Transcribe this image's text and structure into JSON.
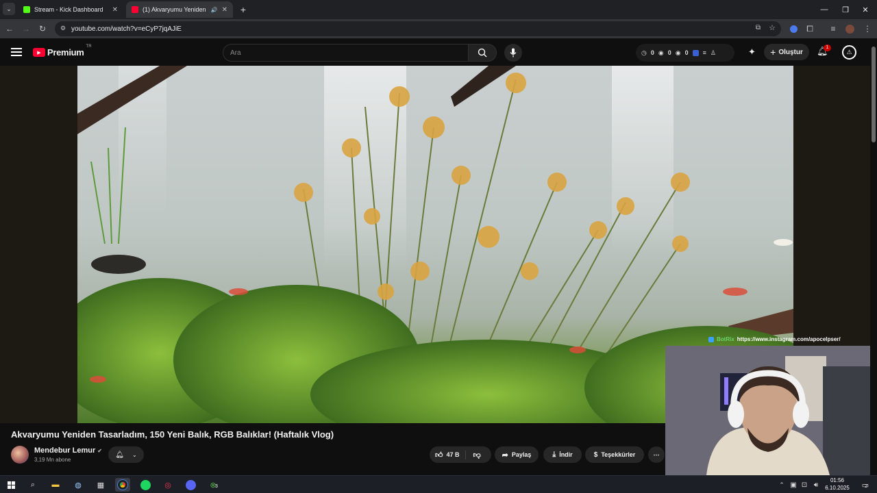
{
  "browser": {
    "tabs": [
      {
        "title": "Stream - Kick Dashboard",
        "favicon_color": "#53fc18"
      },
      {
        "title": "(1) Akvaryumu Yeniden Tasa",
        "favicon_color": "#ff0033"
      }
    ],
    "url": "youtube.com/watch?v=eCyP7jqAJiE"
  },
  "youtube": {
    "logo_text": "Premium",
    "region": "TR",
    "search_placeholder": "Ara",
    "ext_counts": [
      "0",
      "0",
      "0"
    ],
    "create_label": "Oluştur",
    "notification_count": "1"
  },
  "video": {
    "title": "Akvaryumu Yeniden Tasarladım, 150 Yeni Balık, RGB Balıklar! (Haftalık Vlog)",
    "channel": "Mendebur Lemur",
    "subscribers": "3,19 Mn abone",
    "likes": "47 B",
    "share_label": "Paylaş",
    "download_label": "İndir",
    "thanks_label": "Teşekkürler"
  },
  "overlay": {
    "bot": "BotRix",
    "link": "https://www.instagram.com/apocelpser/"
  },
  "taskbar": {
    "time": "01:56",
    "date": "6.10.2025",
    "notif_count": "2",
    "xbox_badge": "3"
  }
}
